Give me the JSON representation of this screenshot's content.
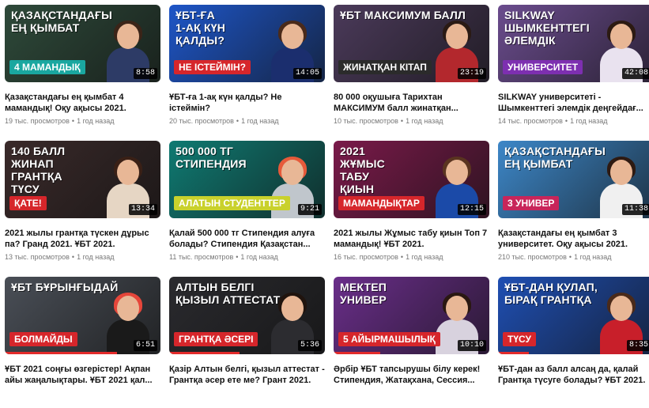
{
  "videos": [
    {
      "title": "Қазақстандағы ең қымбат 4 мамандық! Оқу ақысы 2021.",
      "views": "19 тыс. просмотров",
      "age": "1 год назад",
      "duration": "8:58",
      "thumb_lines": [
        "ҚАЗАҚСТАНДАҒЫ",
        "ЕҢ ҚЫМБАТ",
        "4 МАМАНДЫҚ"
      ],
      "bg": "#2e4a3a",
      "banner_color": "#1aa7a0",
      "hair": "#3b2418",
      "torso": "#2d3b66",
      "progress": 0
    },
    {
      "title": "ҰБТ-ға 1-ақ күн қалды? Не істеймін?",
      "views": "20 тыс. просмотров",
      "age": "1 год назад",
      "duration": "14:05",
      "thumb_lines": [
        "ҰБТ-ҒА",
        "1-АҚ КҮН",
        "ҚАЛДЫ?",
        "НЕ ІСТЕЙМІН?"
      ],
      "bg": "#1e56c8",
      "banner_color": "#d6262b",
      "hair": "#4a2a1a",
      "torso": "#1b2e6e",
      "progress": 0
    },
    {
      "title": "80 000 оқушыға Тарихтан МАКСИМУМ балл жинатқан...",
      "views": "10 тыс. просмотров",
      "age": "1 год назад",
      "duration": "23:19",
      "thumb_lines": [
        "ҰБТ МАКСИМУМ БАЛЛ",
        "ЖИНАТҚАН КІТАП"
      ],
      "bg": "#4b3a5a",
      "banner_color": "#2b2b2b",
      "hair": "#2a1a14",
      "torso": "#b3282d",
      "progress": 0
    },
    {
      "title": "SILKWAY университеті - Шымкенттегі элемдік деңгейдағ...",
      "views": "14 тыс. просмотров",
      "age": "1 год назад",
      "duration": "42:08",
      "thumb_lines": [
        "SILKWAY",
        "ШЫМКЕНТТЕГІ",
        "ӘЛЕМДІК",
        "УНИВЕРСИТЕТ"
      ],
      "bg": "#6b4c8e",
      "banner_color": "#7d2fb0",
      "hair": "#2c1a12",
      "torso": "#e9e2ef",
      "progress": 0
    },
    {
      "title": "2021 жылы грантқа түскен дұрыс па? Гранд 2021. ҰБТ 2021.",
      "views": "13 тыс. просмотров",
      "age": "1 год назад",
      "duration": "13:34",
      "thumb_lines": [
        "140 БАЛЛ",
        "ЖИНАП",
        "ГРАНТҚА",
        "ТҮСУ",
        "ҚАТЕ!"
      ],
      "bg": "#3a2a2a",
      "banner_color": "#d6262b",
      "hair": "#3a2016",
      "torso": "#e6d6c4",
      "progress": 0
    },
    {
      "title": "Қалай 500 000 тг Стипендия алуға болады? Стипендия Қазақстан...",
      "views": "11 тыс. просмотров",
      "age": "1 год назад",
      "duration": "9:21",
      "thumb_lines": [
        "500 000 ТГ",
        "СТИПЕНДИЯ",
        "АЛАТЫН СТУДЕНТТЕР"
      ],
      "bg": "#0f7a72",
      "banner_color": "#c9d12c",
      "hair": "#e65a3a",
      "torso": "#c0c6cc",
      "progress": 0
    },
    {
      "title": "2021 жылы Жұмыс табу қиын Топ 7 мамандық! ҰБТ 2021.",
      "views": "16 тыс. просмотров",
      "age": "1 год назад",
      "duration": "12:15",
      "thumb_lines": [
        "2021",
        "ЖҰМЫС",
        "ТАБУ",
        "ҚИЫН",
        "МАМАНДЫҚТАР"
      ],
      "bg": "#7a1a4a",
      "banner_color": "#d6262b",
      "hair": "#5a3420",
      "torso": "#1b4aa8",
      "progress": 0
    },
    {
      "title": "Қазақстандағы ең қымбат 3 университет. Оқу ақысы 2021.",
      "views": "210 тыс. просмотров",
      "age": "1 год назад",
      "duration": "11:38",
      "thumb_lines": [
        "ҚАЗАҚСТАНДАҒЫ",
        "ЕҢ ҚЫМБАТ",
        "3 УНИВЕР"
      ],
      "bg": "#3d87c8",
      "banner_color": "#c8255a",
      "hair": "#2e1a12",
      "torso": "#f0f0f0",
      "progress": 0
    },
    {
      "title": "ҰБТ 2021 соңғы өзгерістер! Ақпан айы жаңалықтары. ҰБТ 2021 қал...",
      "views": "",
      "age": "",
      "duration": "6:51",
      "thumb_lines": [
        "ҰБТ БҰРЫНҒЫДАЙ",
        "БОЛМАЙДЫ"
      ],
      "bg": "#4a4f57",
      "banner_color": "#d6262b",
      "hair": "#e6463a",
      "torso": "#1a1a1a",
      "progress": 0.72
    },
    {
      "title": "Қазір Алтын белгі, қызыл аттестат - Грантқа әсер ете ме? Грант 2021.",
      "views": "",
      "age": "",
      "duration": "5:36",
      "thumb_lines": [
        "АЛТЫН БЕЛГІ",
        "ҚЫЗЫЛ АТТЕСТАТ",
        "ГРАНТҚА ӘСЕРІ"
      ],
      "bg": "#2a2a2e",
      "banner_color": "#d6262b",
      "hair": "#20140e",
      "torso": "#2c2c30",
      "progress": 0.45
    },
    {
      "title": "Әрбір ҰБТ тапсырушы білу керек! Стипендия, Жатақхана, Сессия...",
      "views": "",
      "age": "",
      "duration": "10:10",
      "thumb_lines": [
        "МЕКТЕП",
        "УНИВЕР",
        "5 АЙЫРМАШЫЛЫҚ"
      ],
      "bg": "#6a2e8a",
      "banner_color": "#d6262b",
      "hair": "#2a1812",
      "torso": "#d8d2de",
      "progress": 0.3
    },
    {
      "title": "ҰБТ-дан аз балл алсаң да, қалай Грантқа түсуге болады? ҰБТ 2021.",
      "views": "",
      "age": "",
      "duration": "8:35",
      "thumb_lines": [
        "ҰБТ-ДАН ҚУЛАП,",
        "БІРАҚ ГРАНТҚА",
        "ТҮСУ"
      ],
      "bg": "#1f4fb3",
      "banner_color": "#d6262b",
      "hair": "#4a2a1a",
      "torso": "#c81f2a",
      "progress": 0.2
    }
  ],
  "meta_separator": "•"
}
